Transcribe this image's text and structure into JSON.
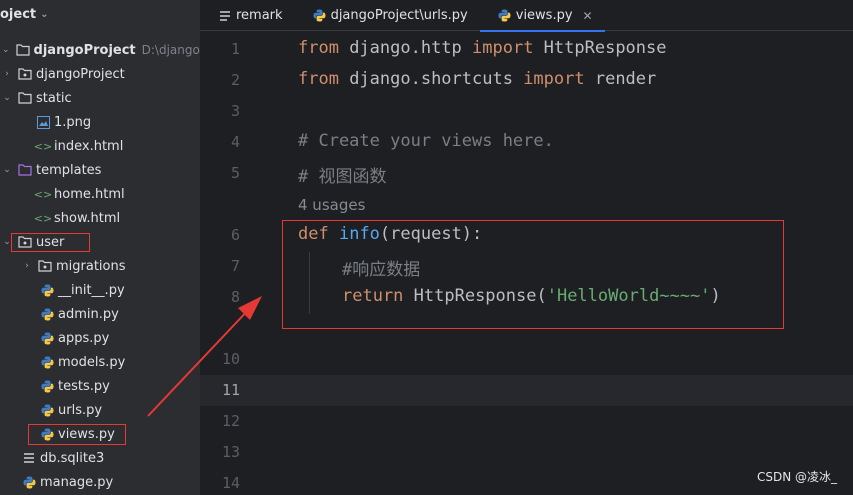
{
  "sidebar": {
    "header": "oject",
    "root": {
      "label": "djangoProject",
      "path": "D:\\djangoProj"
    },
    "items": [
      {
        "label": "djangoProject",
        "type": "folder"
      },
      {
        "label": "static",
        "type": "folder"
      },
      {
        "label": "1.png",
        "type": "image"
      },
      {
        "label": "index.html",
        "type": "html"
      },
      {
        "label": "templates",
        "type": "folder"
      },
      {
        "label": "home.html",
        "type": "html"
      },
      {
        "label": "show.html",
        "type": "html"
      },
      {
        "label": "user",
        "type": "folder"
      },
      {
        "label": "migrations",
        "type": "folder"
      },
      {
        "label": "__init__.py",
        "type": "py"
      },
      {
        "label": "admin.py",
        "type": "py"
      },
      {
        "label": "apps.py",
        "type": "py"
      },
      {
        "label": "models.py",
        "type": "py"
      },
      {
        "label": "tests.py",
        "type": "py"
      },
      {
        "label": "urls.py",
        "type": "py"
      },
      {
        "label": "views.py",
        "type": "py"
      },
      {
        "label": "db.sqlite3",
        "type": "db"
      },
      {
        "label": "manage.py",
        "type": "py"
      }
    ]
  },
  "tabs": [
    {
      "label": "remark"
    },
    {
      "label": "djangoProject\\urls.py"
    },
    {
      "label": "views.py"
    }
  ],
  "editor": {
    "line_numbers": [
      "1",
      "2",
      "3",
      "4",
      "5",
      "6",
      "7",
      "8",
      "10",
      "11",
      "12",
      "13",
      "14"
    ],
    "usages_hint": "4 usages",
    "code": {
      "l1_from": "from",
      "l1_mod": " django.http ",
      "l1_import": "import",
      "l1_name": " HttpResponse",
      "l2_from": "from",
      "l2_mod": " django.shortcuts ",
      "l2_import": "import",
      "l2_name": " render",
      "l4": "# Create your views here.",
      "l5": "# 视图函数",
      "l6_def": "def",
      "l6_fn": "info",
      "l6_args": "(request):",
      "l7": "#响应数据",
      "l8_return": "return",
      "l8_call": " HttpResponse(",
      "l8_str": "'HelloWorld~~~~'",
      "l8_close": ")"
    }
  },
  "watermark": "CSDN @凌冰_",
  "colors": {
    "annotation": "#e53935",
    "keyword": "#cf8e6d",
    "function": "#56a8f5",
    "string": "#6aab73",
    "comment": "#7a7e85"
  }
}
